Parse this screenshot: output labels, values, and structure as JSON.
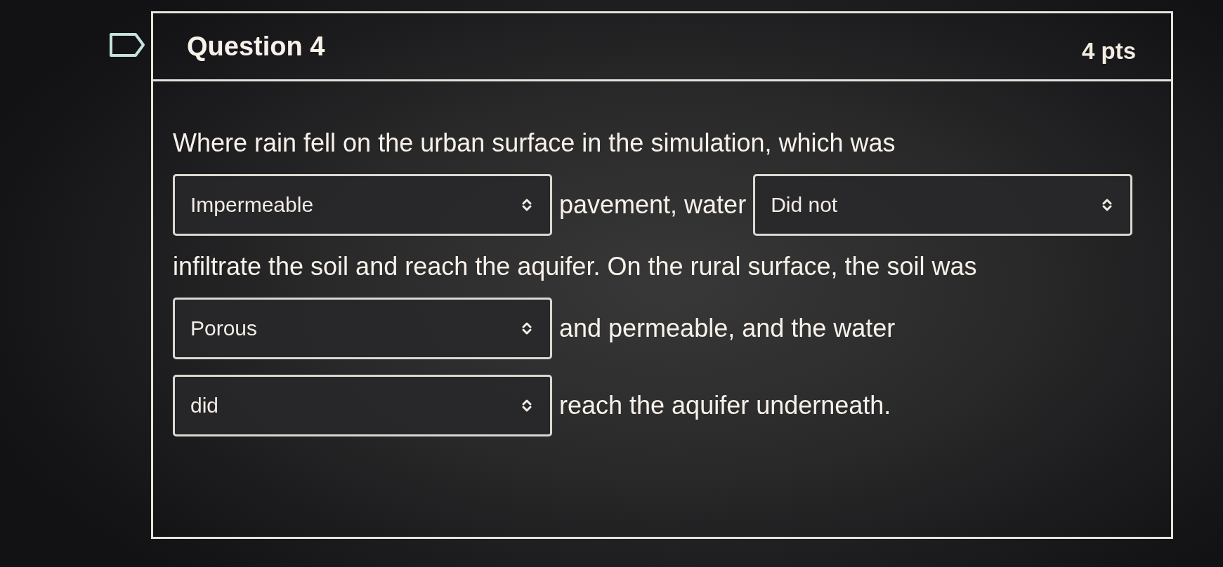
{
  "question": {
    "title": "Question 4",
    "points": "4 pts"
  },
  "prompt": [
    {
      "kind": "text",
      "text": "Where rain fell on the urban surface in the simulation, which was"
    },
    {
      "kind": "dropdown",
      "value": "Impermeable"
    },
    {
      "kind": "text",
      "text": "pavement, water"
    },
    {
      "kind": "dropdown",
      "value": "Did not"
    },
    {
      "kind": "text",
      "text": "infiltrate the soil and reach the aquifer. On the rural surface, the soil was"
    },
    {
      "kind": "dropdown",
      "value": "Porous"
    },
    {
      "kind": "text",
      "text": "and permeable, and the water"
    },
    {
      "kind": "dropdown",
      "value": "did"
    },
    {
      "kind": "text",
      "text": "reach the aquifer underneath."
    }
  ]
}
